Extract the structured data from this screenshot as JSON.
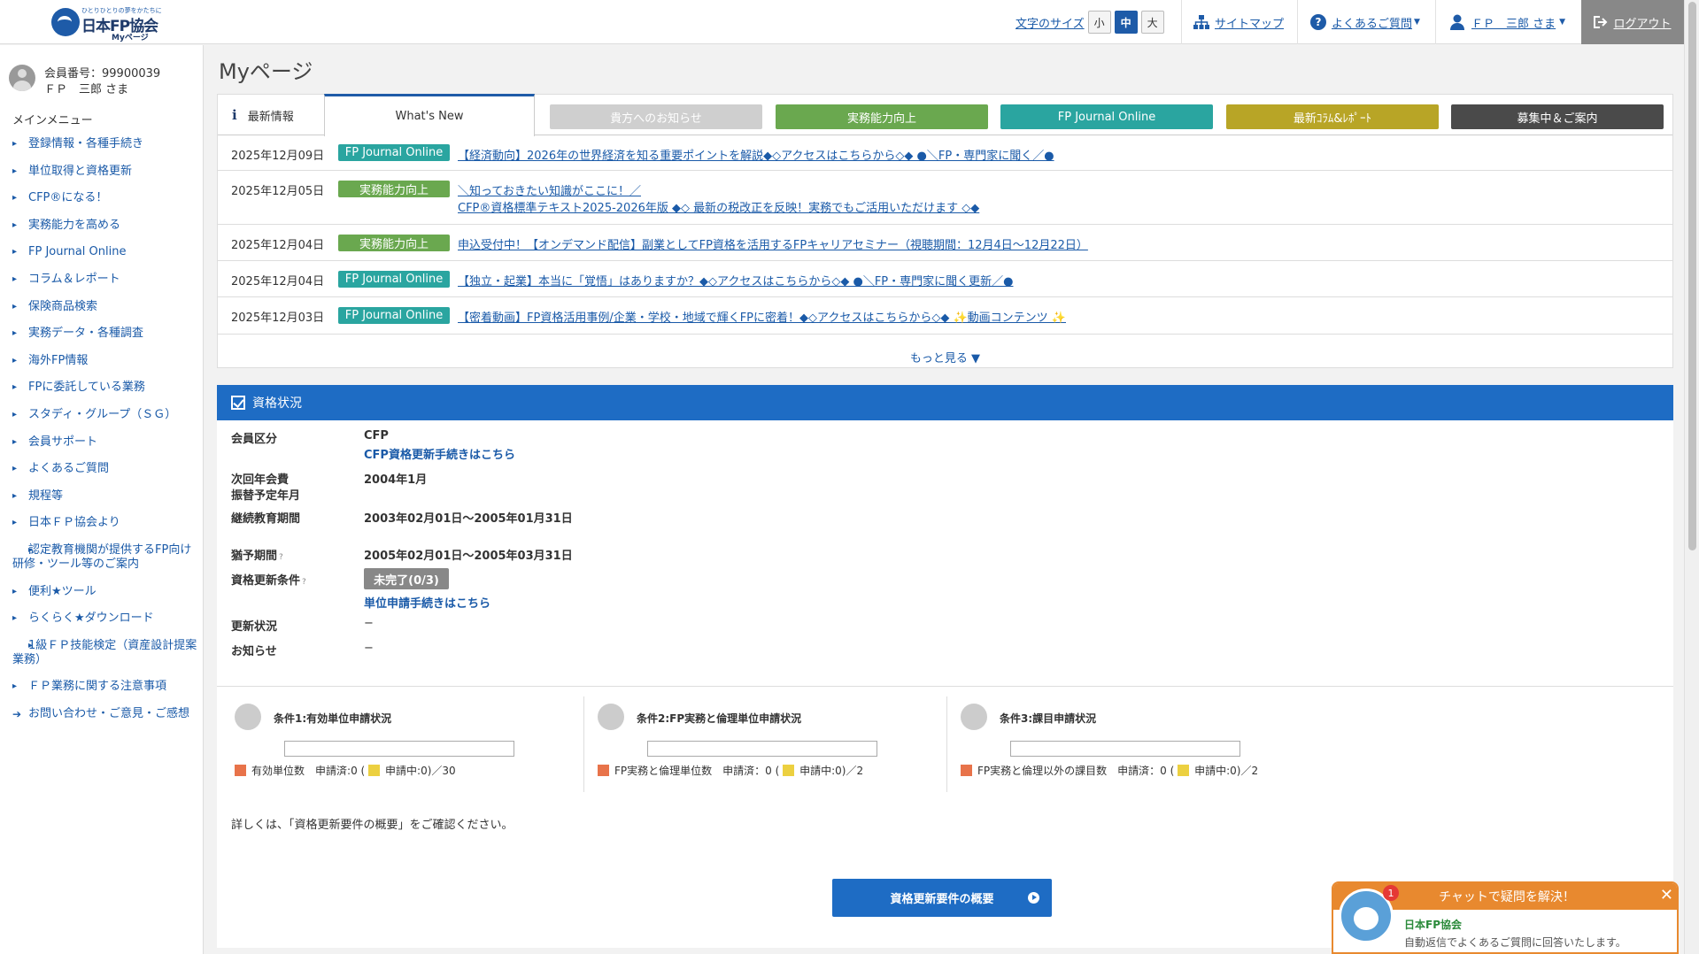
{
  "header": {
    "logo_tagline": "ひとりひとりの夢をかたちに",
    "logo_name": "日本FP協会",
    "logo_sub": "Myページ",
    "font_size_label": "文字のサイズ",
    "font_sizes": [
      "小",
      "中",
      "大"
    ],
    "font_size_selected": "中",
    "sitemap": "サイトマップ",
    "faq": "よくあるご質問",
    "user": "ＦＰ　三郎 さま",
    "logout": "ログアウト"
  },
  "sidebar": {
    "member_no": "会員番号：99900039",
    "member_name": "ＦＰ　三郎 さま",
    "menu_title": "メインメニュー",
    "items": [
      {
        "label": "登録情報・各種手続き"
      },
      {
        "label": "単位取得と資格更新"
      },
      {
        "label": "CFP®になる！"
      },
      {
        "label": "実務能力を高める"
      },
      {
        "label": "FP Journal Online"
      },
      {
        "label": "コラム＆レポート"
      },
      {
        "label": "保険商品検索"
      },
      {
        "label": "実務データ・各種調査"
      },
      {
        "label": "海外FP情報"
      },
      {
        "label": "FPに委託している業務"
      },
      {
        "label": "スタディ・グループ（ＳＧ）"
      },
      {
        "label": "会員サポート"
      },
      {
        "label": "よくあるご質問"
      },
      {
        "label": "規程等"
      },
      {
        "label": "日本ＦＰ協会より"
      },
      {
        "label": "認定教育機関が提供するFP向け研修・ツール等のご案内"
      },
      {
        "label": "便利★ツール"
      },
      {
        "label": "らくらく★ダウンロード"
      },
      {
        "label": "1級ＦＰ技能検定（資産設計提案業務）"
      },
      {
        "label": "ＦＰ業務に関する注意事項"
      },
      {
        "label": "お問い合わせ・ご意見・ご感想"
      }
    ]
  },
  "main": {
    "page_title": "Myページ",
    "news": {
      "tab_latest": "最新情報",
      "tab_whats_new": "What's New",
      "tab_buttons": [
        {
          "label": "貴方へのお知らせ",
          "color": "#cfcfcf"
        },
        {
          "label": "実務能力向上",
          "color": "#6aa84f"
        },
        {
          "label": "FP Journal Online",
          "color": "#2aa5a0"
        },
        {
          "label": "最新ｺﾗﾑ&ﾚﾎﾟｰﾄ",
          "color": "#b8a526"
        },
        {
          "label": "募集中＆ご案内",
          "color": "#4a4a4a"
        }
      ],
      "rows": [
        {
          "date": "2025年12月09日",
          "badge": "FP Journal Online",
          "badge_color": "#2aa5a0",
          "lines": [
            "【経済動向】2026年の世界経済を知る重要ポイントを解説◆◇アクセスはこちらから◇◆ ●＼FP・専門家に聞く／●"
          ]
        },
        {
          "date": "2025年12月05日",
          "badge": "実務能力向上",
          "badge_color": "#6aa84f",
          "lines": [
            "＼知っておきたい知識がここに！／",
            "CFP®資格標準テキスト2025-2026年版 ◆◇ 最新の税改正を反映！実務でもご活用いただけます ◇◆"
          ]
        },
        {
          "date": "2025年12月04日",
          "badge": "実務能力向上",
          "badge_color": "#6aa84f",
          "lines": [
            "申込受付中！【オンデマンド配信】副業としてFP資格を活用するFPキャリアセミナー（視聴期間：12月4日〜12月22日）"
          ]
        },
        {
          "date": "2025年12月04日",
          "badge": "FP Journal Online",
          "badge_color": "#2aa5a0",
          "lines": [
            "【独立・起業】本当に「覚悟」はありますか？◆◇アクセスはこちらから◇◆ ●＼FP・専門家に聞く更新／●"
          ]
        },
        {
          "date": "2025年12月03日",
          "badge": "FP Journal Online",
          "badge_color": "#2aa5a0",
          "lines": [
            "【密着動画】FP資格活用事例/企業・学校・地域で輝くFPに密着！◆◇アクセスはこちらから◇◆ ✨動画コンテンツ ✨"
          ]
        }
      ],
      "more": "もっと見る ▼"
    },
    "qualification": {
      "title": "資格状況",
      "member_class_label": "会員区分",
      "member_class": "CFP",
      "member_class_link": "CFP資格更新手続きはこちら",
      "next_fee_label_1": "次回年会費",
      "next_fee_label_2": "振替予定年月",
      "next_fee": "2004年1月",
      "edu_period_label": "継続教育期間",
      "edu_period": "2003年02月01日〜2005年01月31日",
      "grace_label": "猶予期間",
      "grace": "2005年02月01日〜2005年03月31日",
      "renew_cond_label": "資格更新条件",
      "renew_status": "未完了(0/3)",
      "unit_link": "単位申請手続きはこちら",
      "update_status_label": "更新状況",
      "update_status": "−",
      "notice_label": "お知らせ",
      "notice": "−",
      "help_mark": "?",
      "conditions": [
        {
          "title": "条件1:有効単位申請状況",
          "legend_main": "有効単位数",
          "applied_label": "申請済:0 (",
          "pending_label": "申請中:0)／30",
          "applied": 0,
          "pending": 0,
          "total": 30
        },
        {
          "title": "条件2:FP実務と倫理単位申請状況",
          "legend_main": "FP実務と倫理単位数",
          "applied_label": "申請済：0 (",
          "pending_label": "申請中:0)／2",
          "applied": 0,
          "pending": 0,
          "total": 2
        },
        {
          "title": "条件3:課目申請状況",
          "legend_main": "FP実務と倫理以外の課目数",
          "applied_label": "申請済：0 (",
          "pending_label": "申請中:0)／2",
          "applied": 0,
          "pending": 0,
          "total": 2
        }
      ],
      "note": "詳しくは、「資格更新要件の概要」をご確認ください。",
      "button": "資格更新要件の概要"
    }
  },
  "chat": {
    "title": "チャットで疑問を解決！",
    "badge_count": "1",
    "org": "日本FP協会",
    "message": "自動返信でよくあるご質問に回答いたします。"
  }
}
